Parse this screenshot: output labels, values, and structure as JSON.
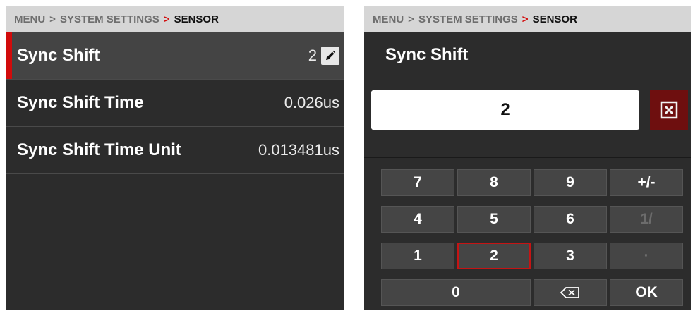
{
  "breadcrumb": {
    "menu": "MENU",
    "sep": ">",
    "system": "SYSTEM SETTINGS",
    "current": "SENSOR"
  },
  "settings": {
    "rows": [
      {
        "label": "Sync Shift",
        "value": "2"
      },
      {
        "label": "Sync Shift Time",
        "value": "0.026us"
      },
      {
        "label": "Sync Shift Time Unit",
        "value": "0.013481us"
      }
    ]
  },
  "keypad": {
    "title": "Sync Shift",
    "input_value": "2",
    "keys": {
      "k7": "7",
      "k8": "8",
      "k9": "9",
      "plusminus": "+/-",
      "k4": "4",
      "k5": "5",
      "k6": "6",
      "fraction": "1/",
      "k1": "1",
      "k2": "2",
      "k3": "3",
      "dot": "·",
      "k0": "0",
      "ok": "OK"
    }
  },
  "colors": {
    "accent": "#d10b0b",
    "panel": "#2c2c2c",
    "key": "#454545"
  }
}
